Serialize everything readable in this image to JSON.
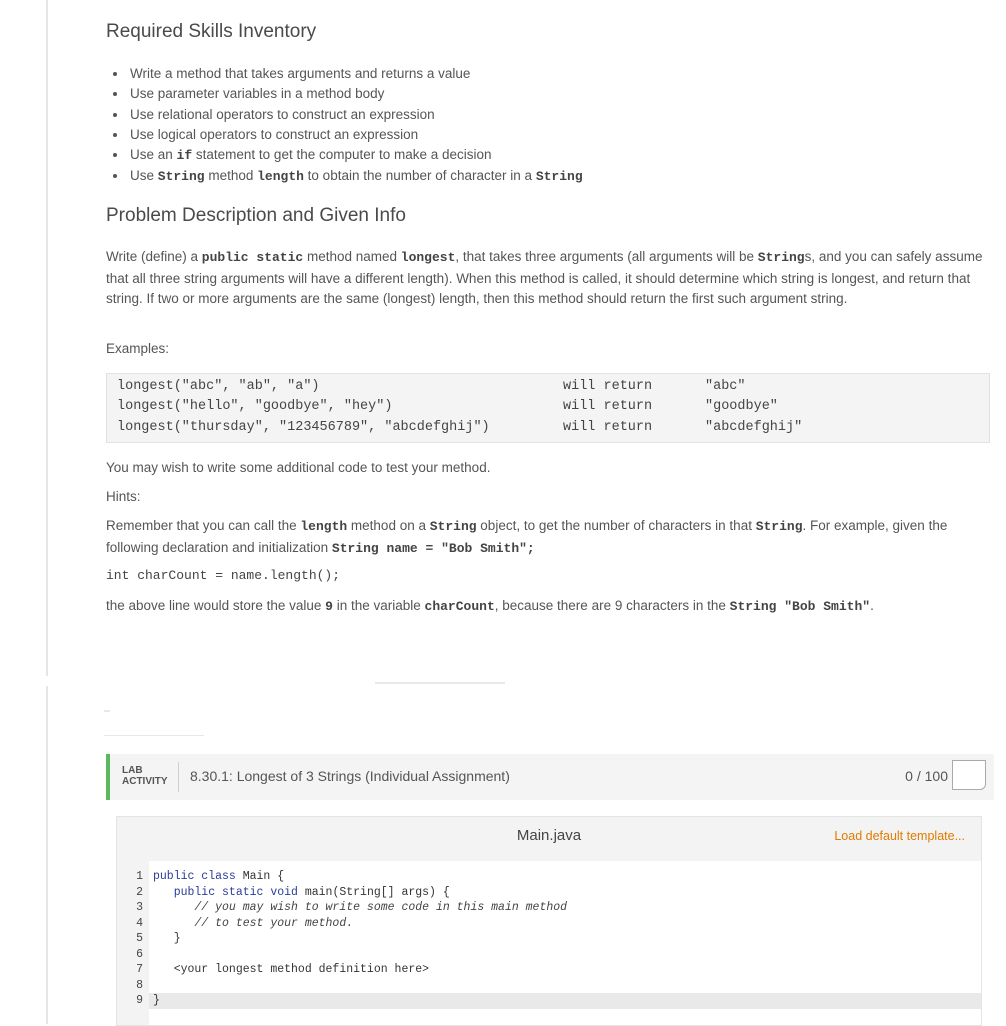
{
  "skills": {
    "heading": "Required Skills Inventory",
    "items": [
      {
        "parts": [
          "Write a method that takes arguments and returns a value"
        ]
      },
      {
        "parts": [
          "Use parameter variables in a method body"
        ]
      },
      {
        "parts": [
          "Use relational operators to construct an expression"
        ]
      },
      {
        "parts": [
          "Use logical operators to construct an expression"
        ]
      },
      {
        "parts": [
          "Use an ",
          "if",
          " statement to get the computer to make a decision"
        ]
      },
      {
        "parts": [
          "Use ",
          "String",
          " method ",
          "length",
          " to obtain the number of character in a ",
          "String"
        ]
      }
    ]
  },
  "problem": {
    "heading": "Problem Description and Given Info",
    "para1": {
      "t1": "Write (define) a ",
      "c1": "public static",
      "t2": " method named ",
      "c2": "longest",
      "t3": ", that takes three arguments (all arguments will be ",
      "c3": "String",
      "t4": "s, and you can safely assume that all three string arguments will have a different length). When this method is called, it should determine which string is longest, and return that string. If two or more arguments are the same (longest) length, then this method should return the first such argument string."
    },
    "examples_label": "Examples:",
    "examples": [
      {
        "call": "longest(\"abc\", \"ab\", \"a\")",
        "verb": "will return",
        "result": "\"abc\""
      },
      {
        "call": "longest(\"hello\", \"goodbye\", \"hey\")",
        "verb": "will return",
        "result": "\"goodbye\""
      },
      {
        "call": "longest(\"thursday\", \"123456789\", \"abcdefghij\")",
        "verb": "will return",
        "result": "\"abcdefghij\""
      }
    ],
    "test_note": "You may wish to write some additional code to test your method.",
    "hints_label": "Hints:",
    "hint": {
      "t1": "Remember that you can call the ",
      "c1": "length",
      "t2": " method on a ",
      "c2": "String",
      "t3": " object, to get the number of characters in that ",
      "c3": "String",
      "t4": ". For example, given the following declaration and initialization ",
      "c4": "String name = \"Bob Smith\";"
    },
    "code_line": "int charCount = name.length();",
    "result": {
      "t1": "the above line would store the value ",
      "c1": "9",
      "t2": " in the variable ",
      "c2": "charCount",
      "t3": ", because there are 9 characters in the ",
      "c3": "String \"Bob Smith\"",
      "t4": "."
    }
  },
  "lab": {
    "tag_line1": "LAB",
    "tag_line2": "ACTIVITY",
    "title": "8.30.1: Longest of 3 Strings (Individual Assignment)",
    "score": "0 / 100",
    "accent": "#5cb85c",
    "editor": {
      "filename": "Main.java",
      "load_template": "Load default template...",
      "line_numbers": [
        "1",
        "2",
        "3",
        "4",
        "5",
        "6",
        "7",
        "8",
        "9"
      ],
      "lines": [
        {
          "kw": "public class",
          "rest": " Main {"
        },
        {
          "kw": "   public static void",
          "rest": " main(String[] args) {"
        },
        {
          "kw": "",
          "rest": "      // you may wish to write some code in this main method"
        },
        {
          "kw": "",
          "rest": "      // to test your method."
        },
        {
          "kw": "",
          "rest": "   }"
        },
        {
          "kw": "",
          "rest": ""
        },
        {
          "kw": "",
          "rest": "   <your longest method definition here>"
        },
        {
          "kw": "",
          "rest": ""
        },
        {
          "kw": "",
          "rest": "}"
        }
      ]
    }
  }
}
